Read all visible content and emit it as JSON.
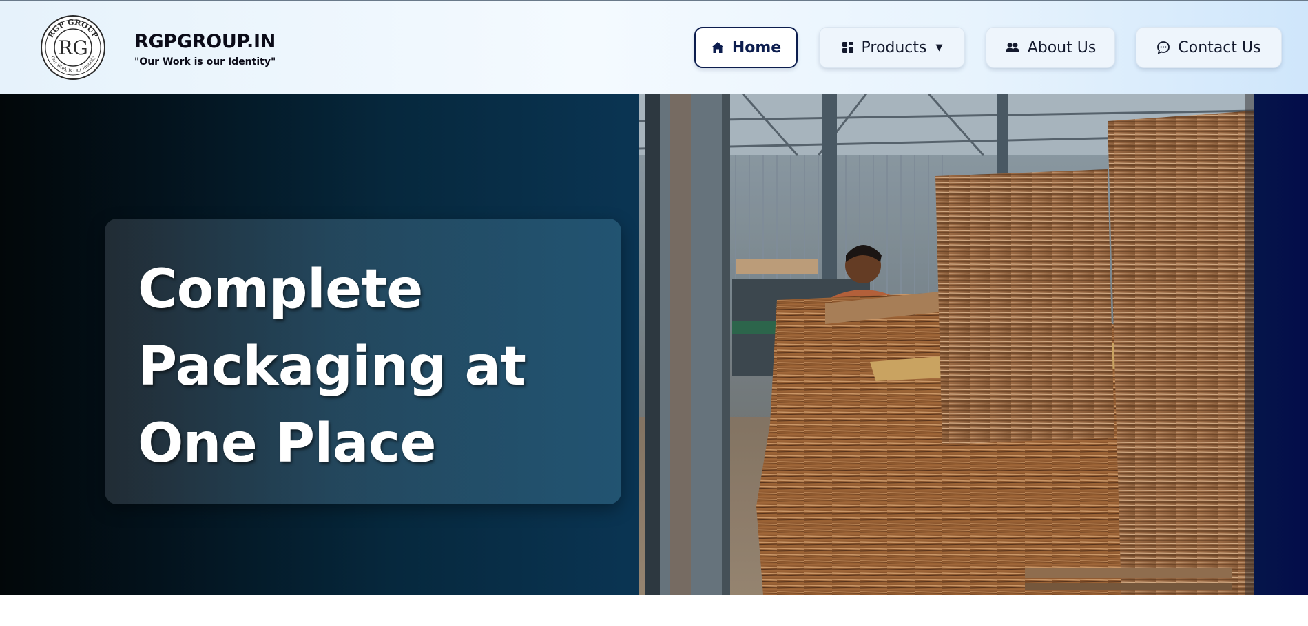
{
  "brand": {
    "title": "RGPGROUP.IN",
    "tagline": "\"Our Work is our Identity\"",
    "logo_top_text": "RGP GROUP",
    "logo_monogram": "RG",
    "logo_bottom_text": "Our Work Is Our Identity"
  },
  "nav": {
    "home": "Home",
    "products": "Products",
    "products_caret": "▼",
    "about": "About Us",
    "contact": "Contact Us",
    "active": "home",
    "active_color": "#0c1d4e"
  },
  "hero": {
    "line1": "Complete",
    "line2": "Packaging at",
    "line3": "One Place",
    "photo_subject": "warehouse-with-stacked-cardboard-sheets"
  },
  "icons": {
    "home": "home-icon",
    "products": "grid-icon",
    "about": "users-icon",
    "contact": "chat-bubble-icon"
  }
}
